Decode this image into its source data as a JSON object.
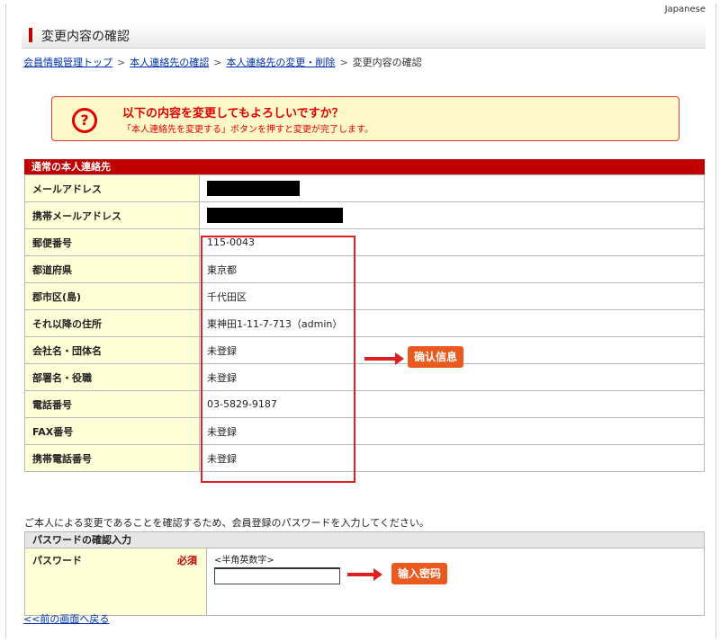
{
  "lang": "Japanese",
  "page_title": "変更内容の確認",
  "breadcrumb": {
    "links": [
      "会員情報管理トップ",
      "本人連絡先の確認",
      "本人連絡先の変更・削除"
    ],
    "current": "変更内容の確認"
  },
  "alert": {
    "line1": "以下の内容を変更してもよろしいですか？",
    "line2": "「本人連絡先を変更する」ボタンを押すと変更が完了します。"
  },
  "section": {
    "title": "通常の本人連絡先",
    "rows": [
      {
        "label": "メールアドレス",
        "value": ""
      },
      {
        "label": "携帯メールアドレス",
        "value": ""
      },
      {
        "label": "郵便番号",
        "value": "115-0043"
      },
      {
        "label": "都道府県",
        "value": "東京都"
      },
      {
        "label": "郡市区(島)",
        "value": "千代田区"
      },
      {
        "label": "それ以降の住所",
        "value": "東神田1-11-7-713（admin）"
      },
      {
        "label": "会社名・団体名",
        "value": "未登録"
      },
      {
        "label": "部署名・役職",
        "value": "未登録"
      },
      {
        "label": "電話番号",
        "value": "03-5829-9187"
      },
      {
        "label": "FAX番号",
        "value": "未登録"
      },
      {
        "label": "携帯電話番号",
        "value": "未登録"
      }
    ]
  },
  "annotations": {
    "confirm_badge": "确认信息",
    "password_badge": "输入密码"
  },
  "note": "ご本人による変更であることを確認するため、会員登録のパスワードを入力してください。",
  "password_section": {
    "title": "パスワードの確認入力",
    "label": "パスワード",
    "required": "必須",
    "hint": "<半角英数字>",
    "value": ""
  },
  "back_link": "<<前の画面へ戻る",
  "colors": {
    "accent": "#c00000",
    "alert_bg": "#fff8c8",
    "label_bg": "#ffffd8",
    "badge": "#ea5a1e"
  }
}
